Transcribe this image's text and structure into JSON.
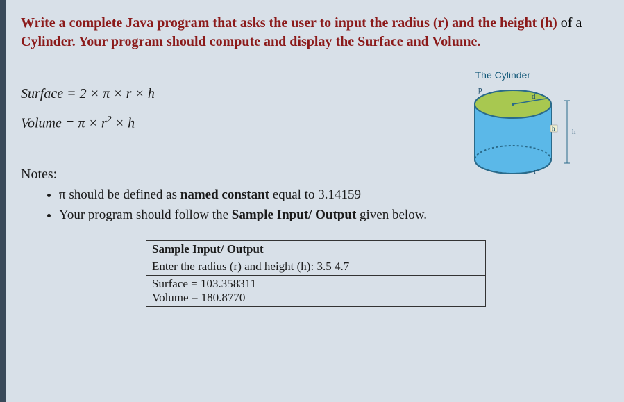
{
  "prompt": {
    "line1_part1": "Write a complete Java program that asks the user to input the ",
    "line1_radius": "radius (r) ",
    "line1_and": "and the ",
    "line1_height": "height (h) ",
    "line1_ofa": "of a",
    "line2_cylinder": "Cylinder. ",
    "line2_rest": "Your program should compute and display the ",
    "line2_surface": "Surface ",
    "line2_and2": "and ",
    "line2_volume": "Volume."
  },
  "cylinder": {
    "label": "The Cylinder",
    "p": "p",
    "d": "d",
    "r": "r",
    "h": "h",
    "h2": "h"
  },
  "formulas": {
    "surface": "Surface = 2 × π × r × h",
    "volume_pre": "Volume = π × r",
    "volume_sup": "2",
    "volume_post": " × h"
  },
  "notes": {
    "title": "Notes:",
    "item1_pi": "π ",
    "item1_rest": "should be defined as ",
    "item1_bold": "named constant ",
    "item1_end": "equal to 3.14159",
    "item2_start": "Your program should follow the ",
    "item2_bold": "Sample Input/ Output ",
    "item2_end": "given below."
  },
  "sample": {
    "header": "Sample Input/ Output",
    "input_line": "Enter the radius (r) and height (h): 3.5  4.7",
    "output_surface": "Surface = 103.358311",
    "output_volume": "Volume = 180.8770"
  }
}
